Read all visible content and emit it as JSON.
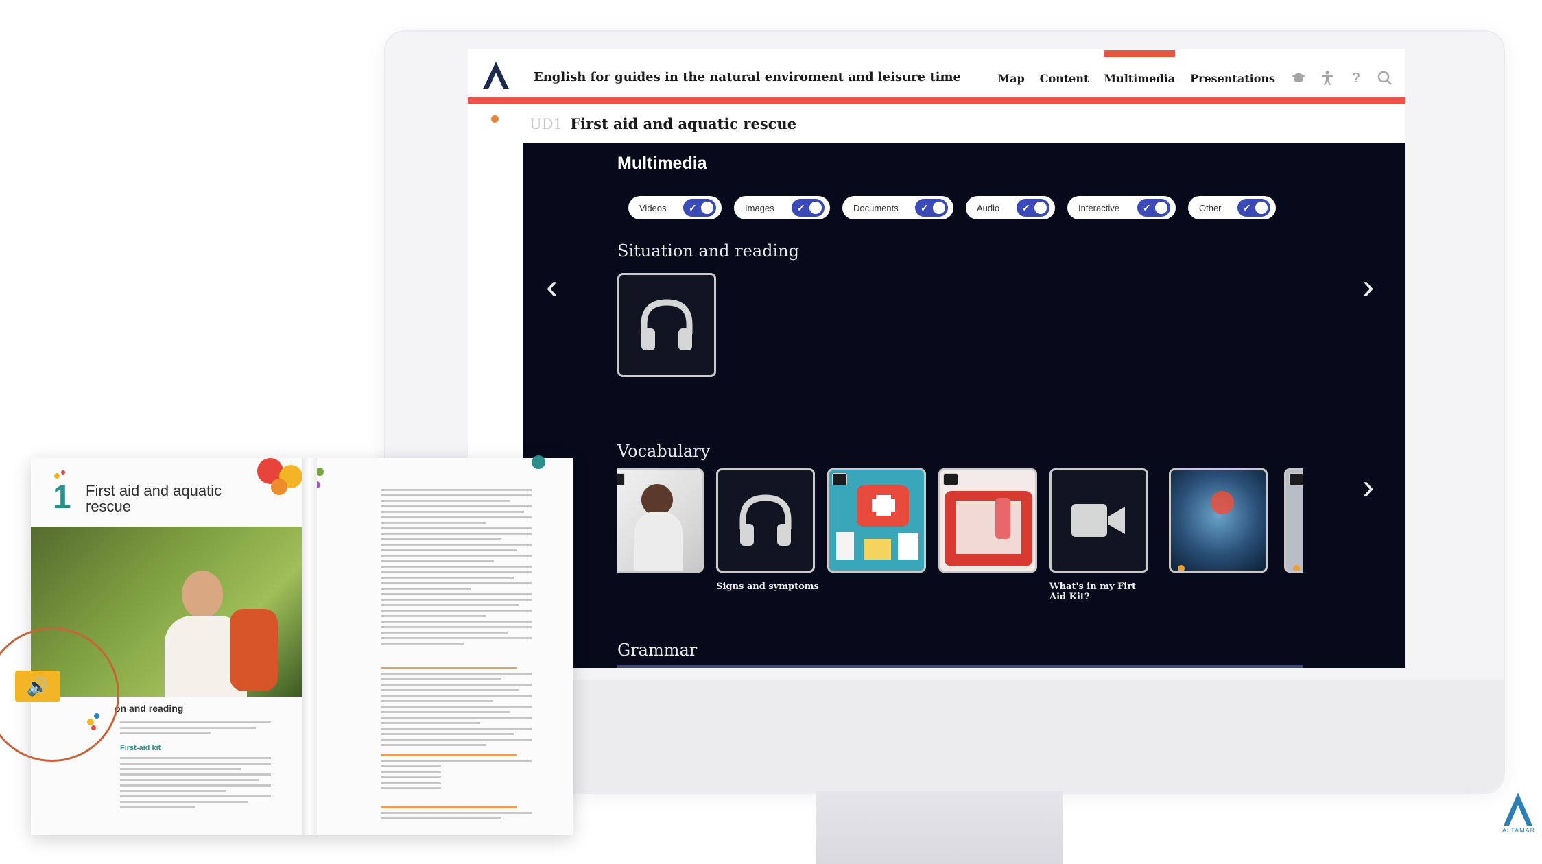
{
  "app": {
    "course_title": "English for guides in the natural enviroment and leisure time",
    "nav": [
      "Map",
      "Content",
      "Multimedia",
      "Presentations"
    ],
    "active_nav": "Multimedia",
    "nav_icons": [
      "graduation-cap-icon",
      "accessibility-icon",
      "help-icon",
      "search-icon"
    ],
    "accent_color": "#e8564a"
  },
  "unit": {
    "code": "UD1",
    "title": "First aid and aquatic rescue"
  },
  "multimedia": {
    "title": "Multimedia",
    "filters": [
      {
        "label": "Videos",
        "enabled": true
      },
      {
        "label": "Images",
        "enabled": true
      },
      {
        "label": "Documents",
        "enabled": true
      },
      {
        "label": "Audio",
        "enabled": true
      },
      {
        "label": "Interactive",
        "enabled": true
      },
      {
        "label": "Other",
        "enabled": true
      }
    ],
    "sections": [
      {
        "title": "Situation and reading",
        "items": [
          {
            "type": "audio",
            "label": ""
          }
        ]
      },
      {
        "title": "Vocabulary",
        "items": [
          {
            "type": "image",
            "label": ""
          },
          {
            "type": "audio",
            "label": "Signs and symptoms"
          },
          {
            "type": "image",
            "label": ""
          },
          {
            "type": "image",
            "label": ""
          },
          {
            "type": "video",
            "label": "What's in my Firt Aid Kit?"
          },
          {
            "type": "image",
            "label": ""
          }
        ]
      },
      {
        "title": "Grammar",
        "items": []
      }
    ]
  },
  "book": {
    "unit_number": "1",
    "title": "First aid and aquatic rescue",
    "subheading": "on and reading",
    "section_label": "First-aid kit"
  },
  "brand": {
    "name": "ALTAMAR"
  }
}
